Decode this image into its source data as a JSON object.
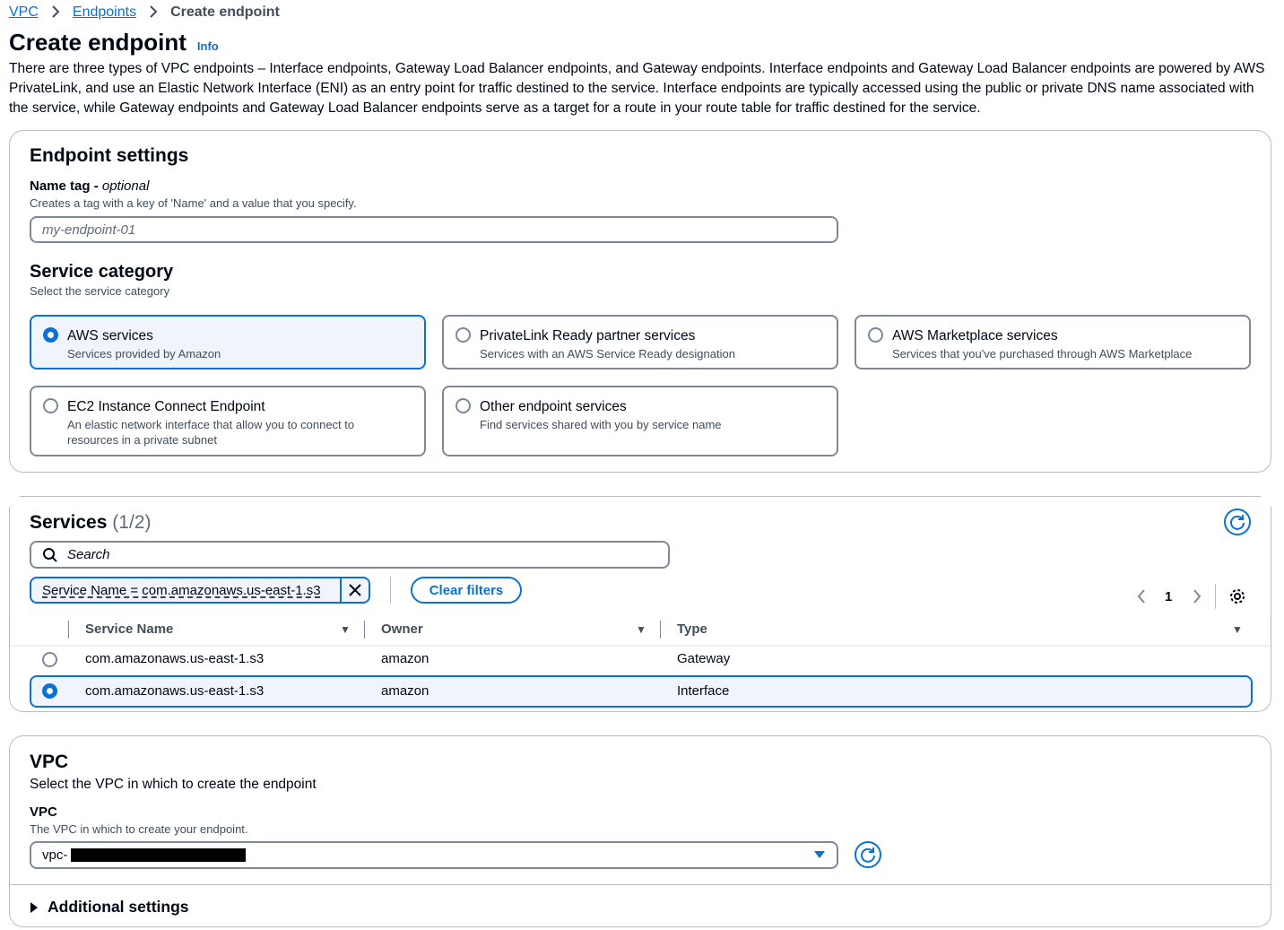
{
  "breadcrumb": {
    "items": [
      {
        "label": "VPC"
      },
      {
        "label": "Endpoints"
      }
    ],
    "current": "Create endpoint"
  },
  "header": {
    "title": "Create endpoint",
    "info": "Info",
    "description": "There are three types of VPC endpoints – Interface endpoints, Gateway Load Balancer endpoints, and Gateway endpoints. Interface endpoints and Gateway Load Balancer endpoints are powered by AWS PrivateLink, and use an Elastic Network Interface (ENI) as an entry point for traffic destined to the service. Interface endpoints are typically accessed using the public or private DNS name associated with the service, while Gateway endpoints and Gateway Load Balancer endpoints serve as a target for a route in your route table for traffic destined for the service."
  },
  "endpoint_settings": {
    "title": "Endpoint settings",
    "name_tag": {
      "label": "Name tag",
      "optional": "optional",
      "description": "Creates a tag with a key of 'Name' and a value that you specify.",
      "placeholder": "my-endpoint-01"
    },
    "service_category": {
      "title": "Service category",
      "description": "Select the service category",
      "options": [
        {
          "title": "AWS services",
          "description": "Services provided by Amazon",
          "selected": true
        },
        {
          "title": "PrivateLink Ready partner services",
          "description": "Services with an AWS Service Ready designation",
          "selected": false
        },
        {
          "title": "AWS Marketplace services",
          "description": "Services that you've purchased through AWS Marketplace",
          "selected": false
        },
        {
          "title": "EC2 Instance Connect Endpoint",
          "description": "An elastic network interface that allow you to connect to resources in a private subnet",
          "selected": false
        },
        {
          "title": "Other endpoint services",
          "description": "Find services shared with you by service name",
          "selected": false
        }
      ]
    }
  },
  "services": {
    "title": "Services",
    "count": "(1/2)",
    "search_placeholder": "Search",
    "filter_chip": "Service Name = com.amazonaws.us-east-1.s3",
    "clear_filters": "Clear filters",
    "page": "1",
    "columns": [
      "Service Name",
      "Owner",
      "Type"
    ],
    "rows": [
      {
        "service_name": "com.amazonaws.us-east-1.s3",
        "owner": "amazon",
        "type": "Gateway",
        "selected": false
      },
      {
        "service_name": "com.amazonaws.us-east-1.s3",
        "owner": "amazon",
        "type": "Interface",
        "selected": true
      }
    ]
  },
  "vpc": {
    "title": "VPC",
    "description": "Select the VPC in which to create the endpoint",
    "field_label": "VPC",
    "field_description": "The VPC in which to create your endpoint.",
    "value_prefix": "vpc-",
    "additional_settings": "Additional settings"
  },
  "colors": {
    "accent": "#0972d3",
    "selected_background": "#f0f4fc",
    "border": "#7d8998"
  }
}
